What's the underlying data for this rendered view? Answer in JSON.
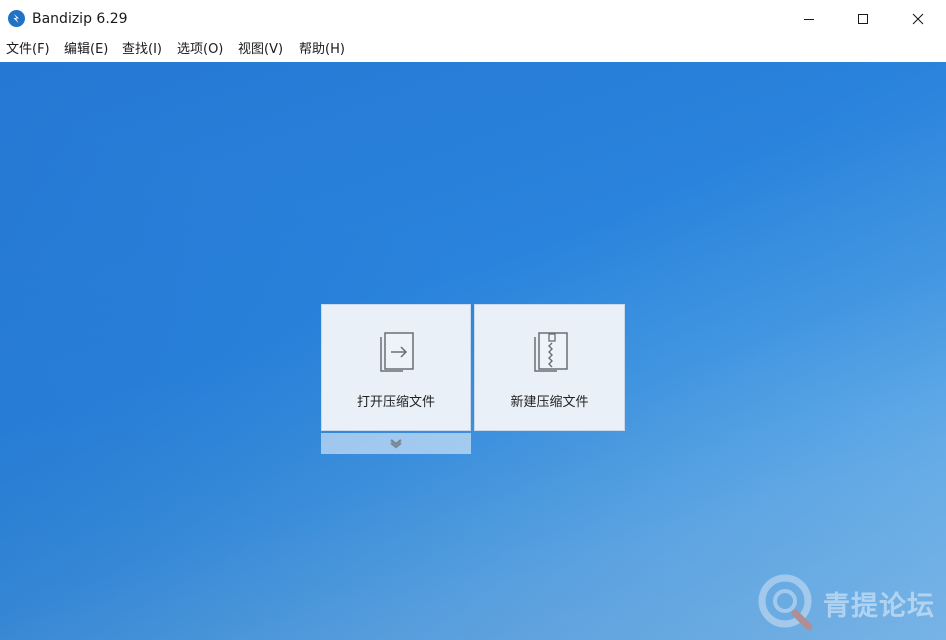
{
  "window": {
    "title": "Bandizip 6.29",
    "app_icon": "bandizip-logo-icon",
    "controls": [
      "minimize-icon",
      "maximize-icon",
      "close-icon"
    ]
  },
  "menu": {
    "items": [
      {
        "label": "文件(F)"
      },
      {
        "label": "编辑(E)"
      },
      {
        "label": "查找(I)"
      },
      {
        "label": "选项(O)"
      },
      {
        "label": "视图(V)"
      },
      {
        "label": "帮助(H)"
      }
    ]
  },
  "main": {
    "background_color": "#2a83dc",
    "tiles": [
      {
        "label": "打开压缩文件",
        "icon": "open-archive-icon"
      },
      {
        "label": "新建压缩文件",
        "icon": "new-archive-icon"
      }
    ],
    "expand_icon": "chevron-down-icon"
  },
  "watermark": {
    "text": "青提论坛"
  }
}
